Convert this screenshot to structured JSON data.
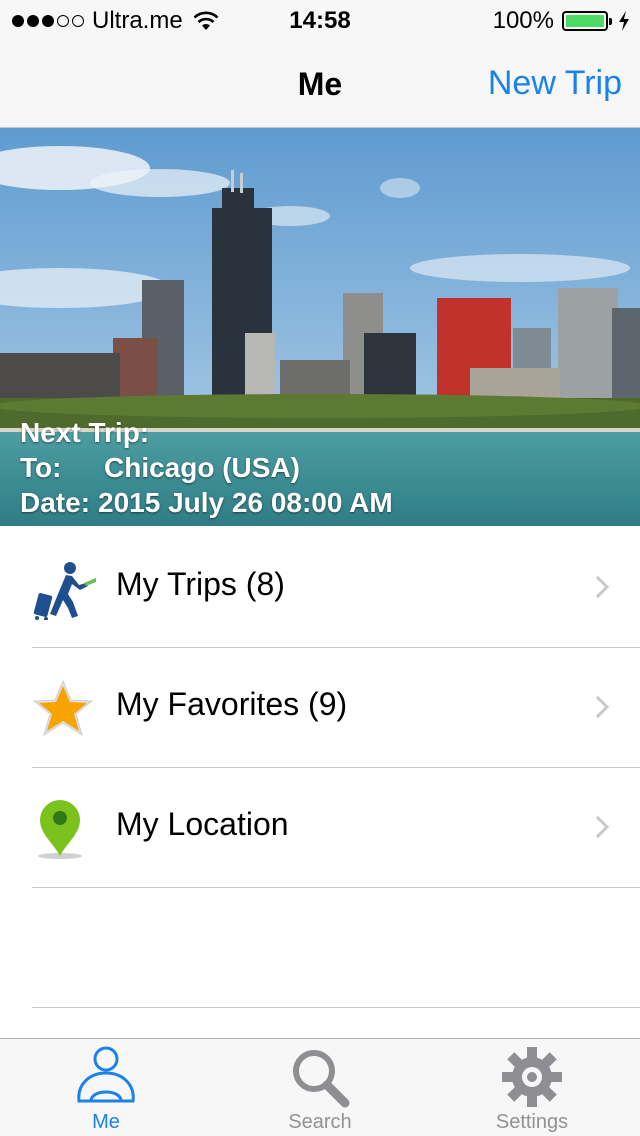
{
  "status_bar": {
    "carrier": "Ultra.me",
    "time": "14:58",
    "battery": "100%"
  },
  "nav": {
    "title": "Me",
    "action": "New Trip"
  },
  "hero": {
    "heading": "Next Trip:",
    "to_label": "To:",
    "to_value": "Chicago (USA)",
    "date_label": "Date:",
    "date_value": "2015 July 26 08:00 AM"
  },
  "list": {
    "items": [
      {
        "label": "My Trips (8)",
        "icon": "traveler-icon"
      },
      {
        "label": "My Favorites (9)",
        "icon": "star-icon"
      },
      {
        "label": "My Location",
        "icon": "map-pin-icon"
      }
    ]
  },
  "tabs": [
    {
      "label": "Me",
      "icon": "person-icon",
      "active": true
    },
    {
      "label": "Search",
      "icon": "search-icon",
      "active": false
    },
    {
      "label": "Settings",
      "icon": "gear-icon",
      "active": false
    }
  ],
  "colors": {
    "accent": "#1a82e8",
    "battery": "#4cd964",
    "star": "#f7a400",
    "pin": "#7cc21e",
    "traveler": "#1f4f8f"
  }
}
